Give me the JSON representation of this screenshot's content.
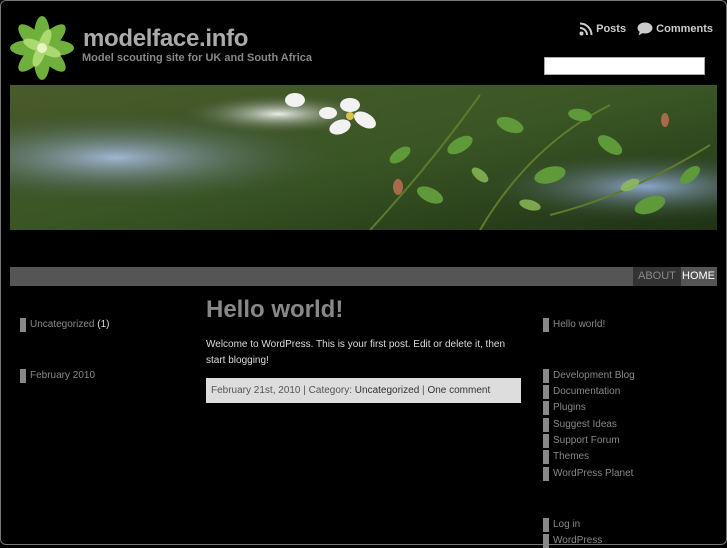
{
  "header": {
    "title": "modelface.info",
    "description": "Model scouting site for UK and South Africa",
    "feeds": {
      "posts": "Posts",
      "comments": "Comments"
    },
    "search": {
      "value": ""
    }
  },
  "nav": {
    "about": "ABOUT",
    "home": "HOME"
  },
  "left_sidebar": {
    "categories": [
      {
        "label": "Uncategorized",
        "count": "(1)"
      }
    ],
    "archives": [
      {
        "label": "February 2010"
      }
    ]
  },
  "post": {
    "title": "Hello world!",
    "body": "Welcome to WordPress. This is your first post. Edit or delete it, then start blogging!",
    "meta": {
      "date": "February 21st, 2010",
      "sep1": " | ",
      "category_prefix": "Category: ",
      "category": "Uncategorized",
      "sep2": " | ",
      "comments": "One comment"
    }
  },
  "right_sidebar": {
    "recent": [
      "Hello world!"
    ],
    "blogroll": [
      "Development Blog",
      "Documentation",
      "Plugins",
      "Suggest Ideas",
      "Support Forum",
      "Themes",
      "WordPress Planet"
    ],
    "meta": [
      "Log in",
      "WordPress"
    ]
  },
  "colors": {
    "background": "#000000",
    "navbar": "#555555",
    "meta_bar": "#dddddd"
  },
  "icons": {
    "feed": "rss-icon",
    "comments": "speech-bubble-icon"
  }
}
